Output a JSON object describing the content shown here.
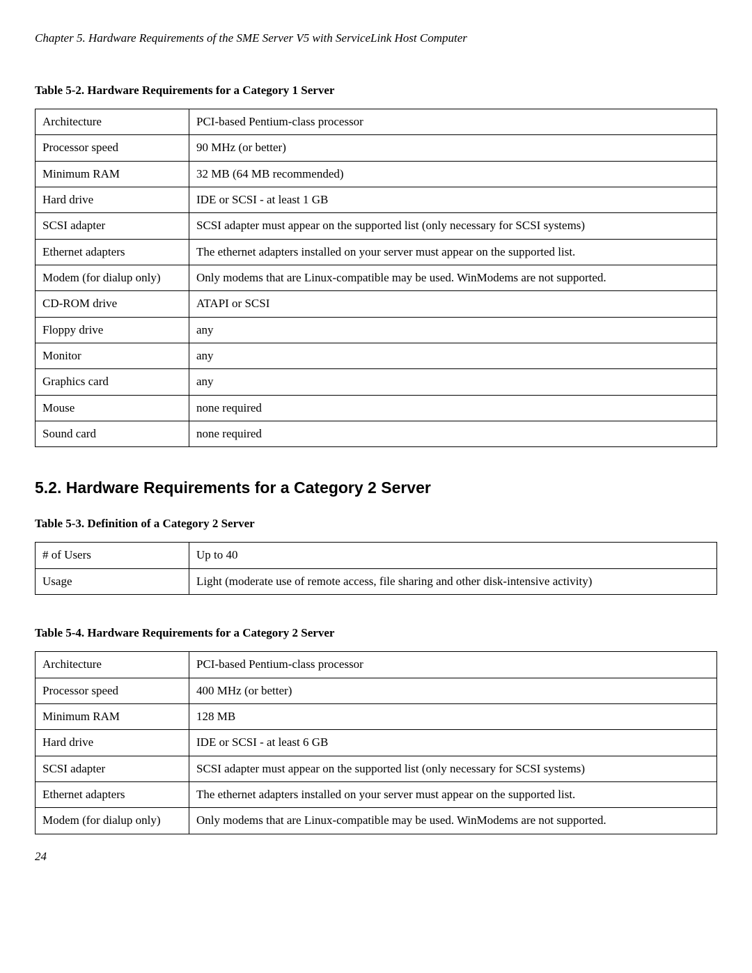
{
  "runningHeader": "Chapter 5. Hardware Requirements of the SME Server V5 with ServiceLink Host Computer",
  "table52": {
    "caption": "Table 5-2. Hardware Requirements for a Category 1 Server",
    "rows": [
      {
        "k": "Architecture",
        "v": "PCI-based Pentium-class processor"
      },
      {
        "k": "Processor speed",
        "v": "90 MHz (or better)"
      },
      {
        "k": "Minimum RAM",
        "v": "32 MB (64 MB recommended)"
      },
      {
        "k": "Hard drive",
        "v": "IDE or SCSI - at least 1 GB"
      },
      {
        "k": "SCSI adapter",
        "v": "SCSI adapter must appear on the  supported list (only necessary for SCSI systems)"
      },
      {
        "k": "Ethernet adapters",
        "v": "The ethernet adapters installed on your server must appear on the supported list."
      },
      {
        "k": "Modem (for dialup only)",
        "v": "Only modems that are Linux-compatible may be used. WinModems are not supported."
      },
      {
        "k": "CD-ROM drive",
        "v": "ATAPI or SCSI"
      },
      {
        "k": "Floppy drive",
        "v": "any"
      },
      {
        "k": "Monitor",
        "v": "any"
      },
      {
        "k": "Graphics card",
        "v": "any"
      },
      {
        "k": "Mouse",
        "v": "none required"
      },
      {
        "k": "Sound card",
        "v": "none required"
      }
    ]
  },
  "sectionHeading": "5.2. Hardware Requirements for a Category 2 Server",
  "table53": {
    "caption": "Table 5-3. Definition of a Category 2 Server",
    "rows": [
      {
        "k": "# of Users",
        "v": "Up to 40"
      },
      {
        "k": "Usage",
        "v": "Light (moderate use of remote access, file sharing and other disk-intensive activity)"
      }
    ]
  },
  "table54": {
    "caption": "Table 5-4. Hardware Requirements for a Category 2 Server",
    "rows": [
      {
        "k": "Architecture",
        "v": "PCI-based Pentium-class processor"
      },
      {
        "k": "Processor speed",
        "v": "400 MHz (or better)"
      },
      {
        "k": "Minimum RAM",
        "v": "128 MB"
      },
      {
        "k": "Hard drive",
        "v": "IDE or SCSI - at least 6 GB"
      },
      {
        "k": "SCSI adapter",
        "v": "SCSI adapter must appear on the  supported list (only necessary for SCSI systems)"
      },
      {
        "k": "Ethernet adapters",
        "v": "The ethernet adapters installed on your server must appear on the supported list."
      },
      {
        "k": "Modem (for dialup only)",
        "v": "Only modems that are Linux-compatible may be used. WinModems are not supported."
      }
    ]
  },
  "pageNumber": "24"
}
